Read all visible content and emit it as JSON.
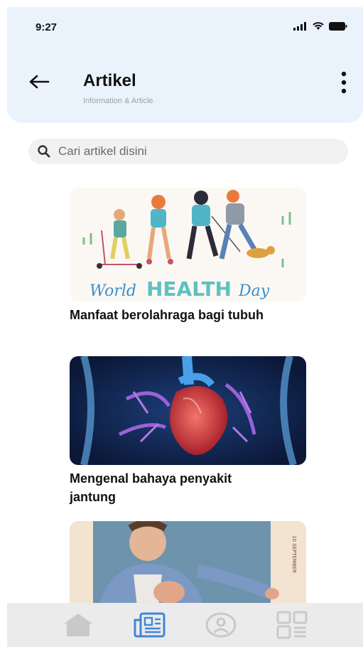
{
  "status": {
    "time": "9:27"
  },
  "header": {
    "title": "Artikel",
    "subtitle": "Information & Article"
  },
  "search": {
    "placeholder": "Cari artikel disini"
  },
  "articles": [
    {
      "title": "Manfaat berolahraga bagi tubuh",
      "image_text": "World HEALTH Day"
    },
    {
      "title": "Mengenal bahaya penyakit jantung"
    },
    {
      "title": "",
      "side_text": "10 SEPTEMBER"
    }
  ],
  "nav": {
    "items": [
      {
        "icon": "home-icon",
        "active": false
      },
      {
        "icon": "article-icon",
        "active": true
      },
      {
        "icon": "profile-icon",
        "active": false
      },
      {
        "icon": "grid-icon",
        "active": false
      }
    ],
    "active_color": "#3f86d6",
    "inactive_color": "#c9c9c9"
  },
  "colors": {
    "header_bg": "#eaf3fc",
    "accent": "#3f86d6"
  }
}
